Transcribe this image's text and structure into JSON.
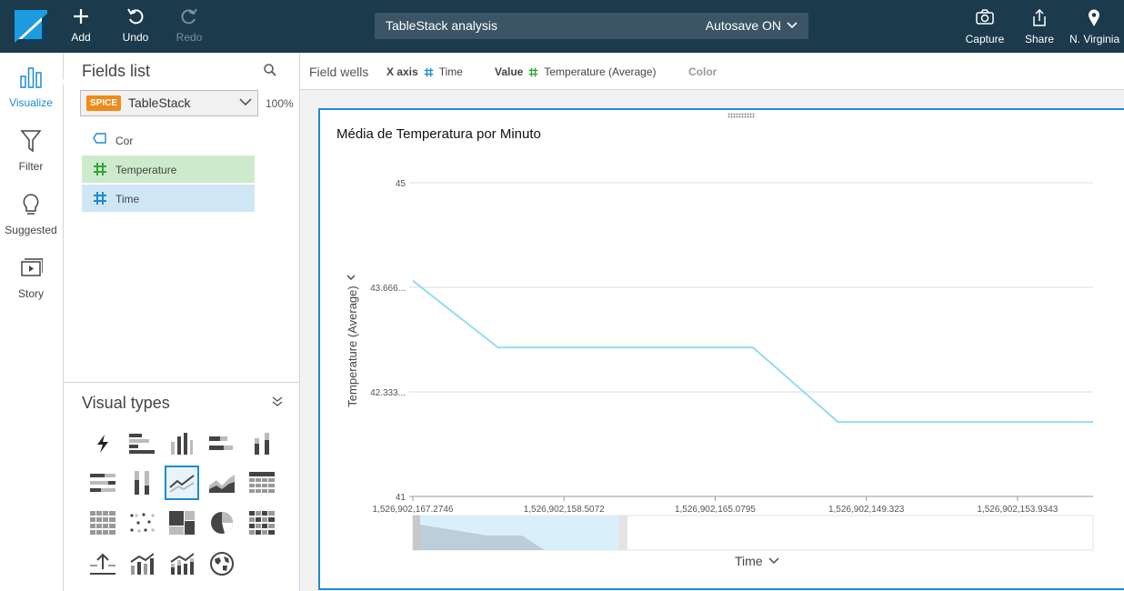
{
  "topbar": {
    "add": "Add",
    "undo": "Undo",
    "redo": "Redo",
    "analysis_title": "TableStack analysis",
    "autosave": "Autosave ON",
    "capture": "Capture",
    "share": "Share",
    "region": "N. Virginia"
  },
  "rail": {
    "visualize": "Visualize",
    "filter": "Filter",
    "suggested": "Suggested",
    "story": "Story"
  },
  "fields": {
    "title": "Fields list",
    "spice": "SPICE",
    "dataset": "TableStack",
    "percent": "100%",
    "items": [
      {
        "label": "Cor",
        "type": "dimension"
      },
      {
        "label": "Temperature",
        "type": "measure"
      },
      {
        "label": "Time",
        "type": "measure"
      }
    ]
  },
  "visual_types": {
    "title": "Visual types",
    "items": [
      "autograph",
      "horizontal-bar",
      "vertical-bar",
      "horizontal-stacked",
      "vertical-stacked",
      "horizontal-100",
      "vertical-100",
      "line",
      "area",
      "pivot-table",
      "table",
      "scatter",
      "tree-map",
      "pie",
      "heat-map",
      "kpi",
      "combo-1",
      "combo-2",
      "geo-map"
    ],
    "selected": "line"
  },
  "wells": {
    "label": "Field wells",
    "x_axis_label": "X axis",
    "x_axis_field": "Time",
    "value_label": "Value",
    "value_field": "Temperature (Average)",
    "color_label": "Color"
  },
  "colors": {
    "accent": "#1d8bd1",
    "line": "#94dcef",
    "topbar": "#1b3a4b",
    "measure": "#2ea637"
  },
  "chart_data": {
    "type": "line",
    "title": "Média de Temperatura por Minuto",
    "xlabel": "Time",
    "ylabel": "Temperature (Average)",
    "ylim": [
      41,
      45
    ],
    "y_ticks": [
      "45",
      "43.666...",
      "42.333...",
      "41"
    ],
    "x_tick_labels": [
      "1,526,902,167.2746",
      "1,526,902,158.5072",
      "1,526,902,165.0795",
      "1,526,902,149.323",
      "1,526,902,153.9343"
    ],
    "series": [
      {
        "values": [
          43.75,
          42.9,
          42.9,
          42.9,
          42.9,
          41.95,
          41.95,
          41.95,
          41.95
        ]
      }
    ],
    "grid": true
  }
}
